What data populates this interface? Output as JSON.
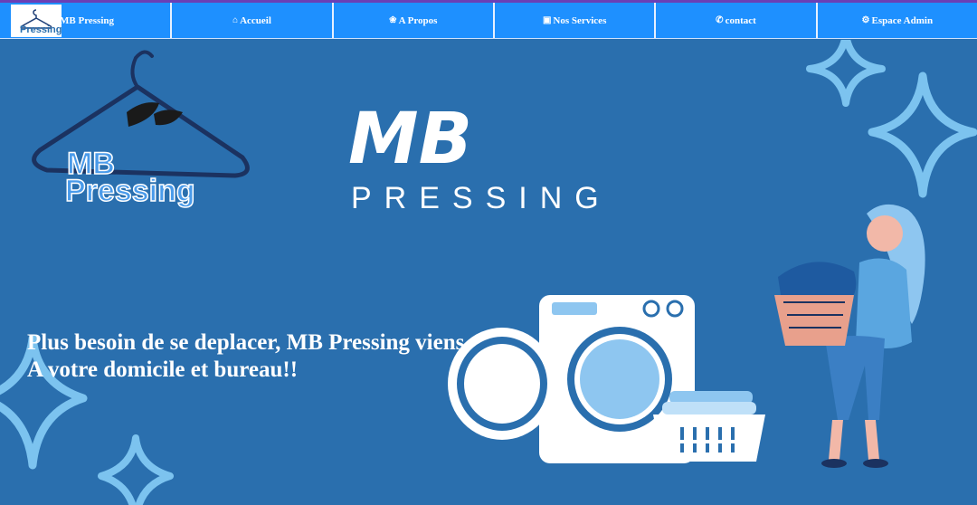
{
  "nav": {
    "brand_label": "MB Pressing",
    "brand_logo_text": "Pressing",
    "items": [
      {
        "label": "Accueil",
        "icon": "home-icon"
      },
      {
        "label": "A Propos",
        "icon": "person-icon"
      },
      {
        "label": "Nos Services",
        "icon": "briefcase-icon"
      },
      {
        "label": "contact",
        "icon": "phone-icon"
      },
      {
        "label": "Espace Admin",
        "icon": "gear-icon"
      }
    ]
  },
  "hero": {
    "logo_mb": "MB",
    "logo_pressing": "Pressing",
    "title_main": "MB",
    "title_sub": "PRESSING",
    "tagline_line1": "Plus besoin de se deplacer, MB Pressing viens",
    "tagline_line2": "A votre domicile et bureau!!"
  },
  "colors": {
    "navbar": "#1e90ff",
    "background": "#2a6fae",
    "sparkle": "#7cc3ef",
    "text": "#ffffff"
  }
}
